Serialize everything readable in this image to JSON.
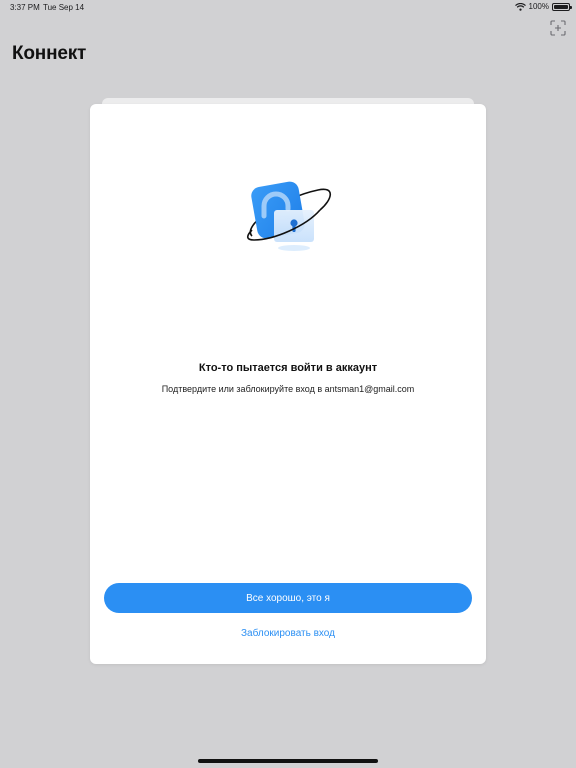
{
  "status_bar": {
    "time": "3:37 PM",
    "date": "Tue Sep 14",
    "battery": "100%",
    "battery_level": 1.0
  },
  "header": {
    "title": "Коннект",
    "action_icon": "scan-plus-icon"
  },
  "modal": {
    "illustration_icon": "unlocked-padlock-icon",
    "title": "Кто-то пытается войти в аккаунт",
    "subtitle": "Подтвердите или заблокируйте вход в antsman1@gmail.com",
    "confirm_label": "Все хорошо, это я",
    "block_label": "Заблокировать вход"
  },
  "colors": {
    "accent": "#2b8ff3",
    "background": "#d1d1d3",
    "card": "#ffffff"
  }
}
